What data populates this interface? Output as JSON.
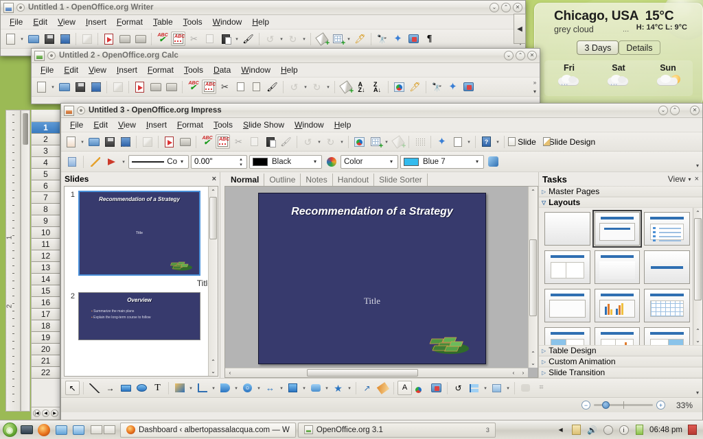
{
  "desktop": {
    "weather": {
      "city": "Chicago, USA",
      "temperature": "15°C",
      "condition": "grey cloud",
      "ellipsis": "...",
      "high_low": "H: 14°C L: 9°C",
      "buttons": {
        "three_days": "3 Days",
        "details": "Details"
      },
      "forecast": [
        {
          "day": "Fri",
          "icon": "rain-cloud-icon"
        },
        {
          "day": "Sat",
          "icon": "rain-cloud-icon"
        },
        {
          "day": "Sun",
          "icon": "sun-cloud-icon"
        }
      ]
    }
  },
  "writer": {
    "title": "Untitled 1 - OpenOffice.org Writer",
    "menus": [
      "File",
      "Edit",
      "View",
      "Insert",
      "Format",
      "Table",
      "Tools",
      "Window",
      "Help"
    ],
    "toolbar_icons": [
      "new-document-icon",
      "dropdown-arrow",
      "open-icon",
      "save-icon",
      "export-pdf-icon",
      "edit-file-icon",
      "export-directly-as-pdf-icon",
      "print-icon",
      "print-preview-icon",
      "spelling-icon",
      "autospellcheck-icon",
      "cut-icon",
      "copy-icon",
      "paste-icon",
      "dropdown-arrow",
      "clone-formatting-icon",
      "undo-icon",
      "redo-icon",
      "hyperlink-icon",
      "table-icon",
      "show-draw-functions-icon",
      "find-replace-icon",
      "navigator-icon",
      "gallery-icon",
      "formatting-marks-icon"
    ]
  },
  "calc": {
    "title": "Untitled 2 - OpenOffice.org Calc",
    "menus": [
      "File",
      "Edit",
      "View",
      "Insert",
      "Format",
      "Tools",
      "Data",
      "Window",
      "Help"
    ],
    "row_headers": [
      "1",
      "2",
      "3",
      "4",
      "5",
      "6",
      "7",
      "8",
      "9",
      "10",
      "11",
      "12",
      "13",
      "14",
      "15",
      "16",
      "17",
      "18",
      "19",
      "20",
      "21",
      "22"
    ],
    "selected_row": "1"
  },
  "impress": {
    "title": "Untitled 3 - OpenOffice.org Impress",
    "menus": [
      "File",
      "Edit",
      "View",
      "Insert",
      "Format",
      "Tools",
      "Slide Show",
      "Window",
      "Help"
    ],
    "toolbar_right": {
      "slide": "Slide",
      "slide_design": "Slide Design"
    },
    "line_format": {
      "line_style_label": "Co",
      "line_width_value": "0.00\"",
      "line_color_label": "Black",
      "area_style_label": "Color",
      "area_fill_label": "Blue 7",
      "area_fill_color": "#33bbee",
      "line_color_swatch": "#000000"
    },
    "slides_panel": {
      "title": "Slides",
      "close": "×",
      "slides": [
        {
          "number": "1",
          "title": "Recommendation of a Strategy",
          "subtitle": "Title",
          "selected": true,
          "caption": "Title"
        },
        {
          "number": "2",
          "title": "Overview",
          "bullets": [
            "Summarize the main plans",
            "Explain the long-term course to follow"
          ],
          "selected": false
        }
      ]
    },
    "view_tabs": [
      {
        "label": "Normal",
        "active": true
      },
      {
        "label": "Outline",
        "active": false
      },
      {
        "label": "Notes",
        "active": false
      },
      {
        "label": "Handout",
        "active": false
      },
      {
        "label": "Slide Sorter",
        "active": false
      }
    ],
    "canvas": {
      "slide_title": "Recommendation of a Strategy",
      "slide_subtitle": "Title",
      "background_color": "#373a6d"
    },
    "tasks_panel": {
      "title": "Tasks",
      "view_label": "View",
      "view_arrow": "▾",
      "close": "×",
      "sections": [
        {
          "label": "Master Pages",
          "open": false
        },
        {
          "label": "Layouts",
          "open": true
        },
        {
          "label": "Table Design",
          "open": false
        },
        {
          "label": "Custom Animation",
          "open": false
        },
        {
          "label": "Slide Transition",
          "open": false
        }
      ],
      "layouts": [
        {
          "name": "blank-slide",
          "selected": false
        },
        {
          "name": "title-content",
          "selected": true
        },
        {
          "name": "title-bullets",
          "selected": false
        },
        {
          "name": "title-two-content",
          "selected": false
        },
        {
          "name": "title-only",
          "selected": false
        },
        {
          "name": "centered-text",
          "selected": false
        },
        {
          "name": "title-empty",
          "selected": false
        },
        {
          "name": "title-chart",
          "selected": false
        },
        {
          "name": "title-table",
          "selected": false
        },
        {
          "name": "title-image-content",
          "selected": false
        },
        {
          "name": "title-content-chart",
          "selected": false
        },
        {
          "name": "title-content-image",
          "selected": false
        }
      ]
    },
    "draw_toolbar": [
      "select-icon",
      "line-icon",
      "arrow-icon",
      "rectangle-icon",
      "ellipse-icon",
      "text-icon",
      "curve-icon",
      "connector-icon",
      "basic-shapes-icon",
      "symbol-shapes-icon",
      "block-arrows-icon",
      "flowchart-icon",
      "callout-shapes-icon",
      "stars-icon",
      "points-icon",
      "glue-points-icon",
      "fontwork-icon",
      "from-file-icon",
      "gallery-icon",
      "rotate-icon",
      "alignment-icon",
      "arrange-icon",
      "shadow-icon",
      "crop-icon"
    ],
    "status": {
      "zoom_level": "33%"
    }
  },
  "taskbar": {
    "launchers": [
      "k-menu-icon",
      "show-desktop-icon",
      "firefox-icon",
      "file-manager-icon",
      "konsole-icon"
    ],
    "pager_count": 2,
    "tasks": [
      {
        "label": "Dashboard ‹ albertopassalacqua.com — W",
        "icon": "firefox-icon",
        "active": false
      },
      {
        "label": "OpenOffice.org 3.1",
        "icon": "openoffice-icon",
        "active": true,
        "badge": "3"
      }
    ],
    "tray_icons": [
      "clipboard-icon",
      "volume-icon",
      "network-icon",
      "info-icon",
      "battery-icon"
    ],
    "clock": "06:48 pm"
  }
}
